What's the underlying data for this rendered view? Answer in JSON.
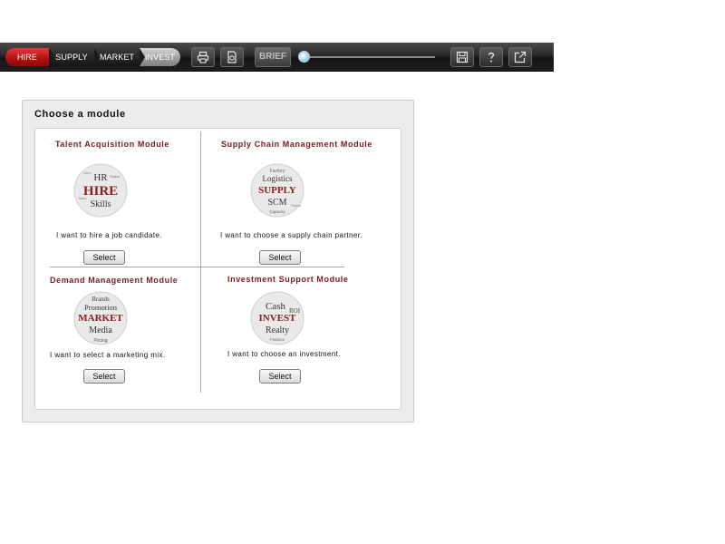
{
  "toolbar": {
    "tabs": [
      {
        "label": "HIRE",
        "active": true
      },
      {
        "label": "SUPPLY",
        "active": false
      },
      {
        "label": "MARKET",
        "active": false
      },
      {
        "label": "INVEST",
        "active": false
      }
    ],
    "brief_label": "BRIEF",
    "icons": {
      "print": "print-icon",
      "document": "document-icon",
      "save": "save-icon",
      "help": "help-icon",
      "export": "export-icon"
    },
    "accent_color": "#b10f0f"
  },
  "panel": {
    "title": "Choose a module",
    "modules": [
      {
        "title": "Talent Acquisition Module",
        "logo_words": {
          "main": "HIRE",
          "top": "HR",
          "bottom": "Skills",
          "small": [
            "Jobs",
            "Talent",
            "Select"
          ]
        },
        "description": "I want to hire a job candidate.",
        "button": "Select"
      },
      {
        "title": "Supply Chain Management Module",
        "logo_words": {
          "main": "SUPPLY",
          "top": "Logistics",
          "bottom": "SCM",
          "small": [
            "Factory",
            "Capacity",
            "Partner"
          ]
        },
        "description": "I want to choose a supply chain partner.",
        "button": "Select"
      },
      {
        "title": "Demand Management Module",
        "logo_words": {
          "main": "MARKET",
          "top": "Promotion",
          "bottom": "Media",
          "small": [
            "Brands",
            "Pricing"
          ]
        },
        "description": "I want to select a marketing mix.",
        "button": "Select"
      },
      {
        "title": "Investment Support Module",
        "logo_words": {
          "main": "INVEST",
          "top": "Cash",
          "bottom": "Realty",
          "small": [
            "ROI",
            "Finance"
          ]
        },
        "description": "I want to choose an investment.",
        "button": "Select"
      }
    ],
    "title_color": "#7a1a1a"
  }
}
